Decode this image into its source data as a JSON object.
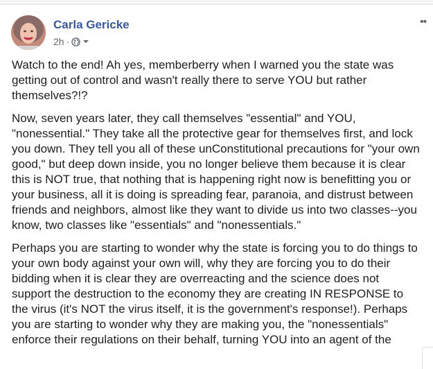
{
  "post": {
    "author": "Carla Gericke",
    "timestamp": "2h",
    "separator": "·",
    "privacy_icon": "globe-icon",
    "dropdown_icon": "chevron-down-icon",
    "more_icon": "ellipsis-icon",
    "more_label": "••",
    "paragraphs": [
      "Watch to the end! Ah yes, memberberry when I warned you the state was getting out of control and wasn't really there to serve YOU but rather themselves?!?",
      "Now, seven years later, they call themselves \"essential\" and YOU, \"nonessential.\" They take all the protective gear for themselves first, and lock you down. They tell you all of these unConstitutional precautions for \"your own good,\" but deep down inside, you no longer believe them because it is clear this is NOT true, that nothing that is happening right now is benefitting you or your business, all it is doing is spreading fear, paranoia, and distrust between friends and neighbors, almost like they want to divide us into two classes--you know, two classes like \"essentials\" and \"nonessentials.\"",
      "Perhaps you are starting to wonder why the state is forcing you to do things to your own body against your own will, why they are forcing you to do their bidding when it is clear they are overreacting and the science does not support the destruction to the economy they are creating IN RESPONSE to the virus (it's NOT the virus itself, it is the government's response!). Perhaps you are starting to wonder why they are making you, the \"nonessentials\" enforce their regulations on their behalf, turning YOU into an agent of the"
    ]
  },
  "colors": {
    "author_link": "#385898",
    "meta_text": "#606770",
    "body_text": "#1c1e21"
  }
}
